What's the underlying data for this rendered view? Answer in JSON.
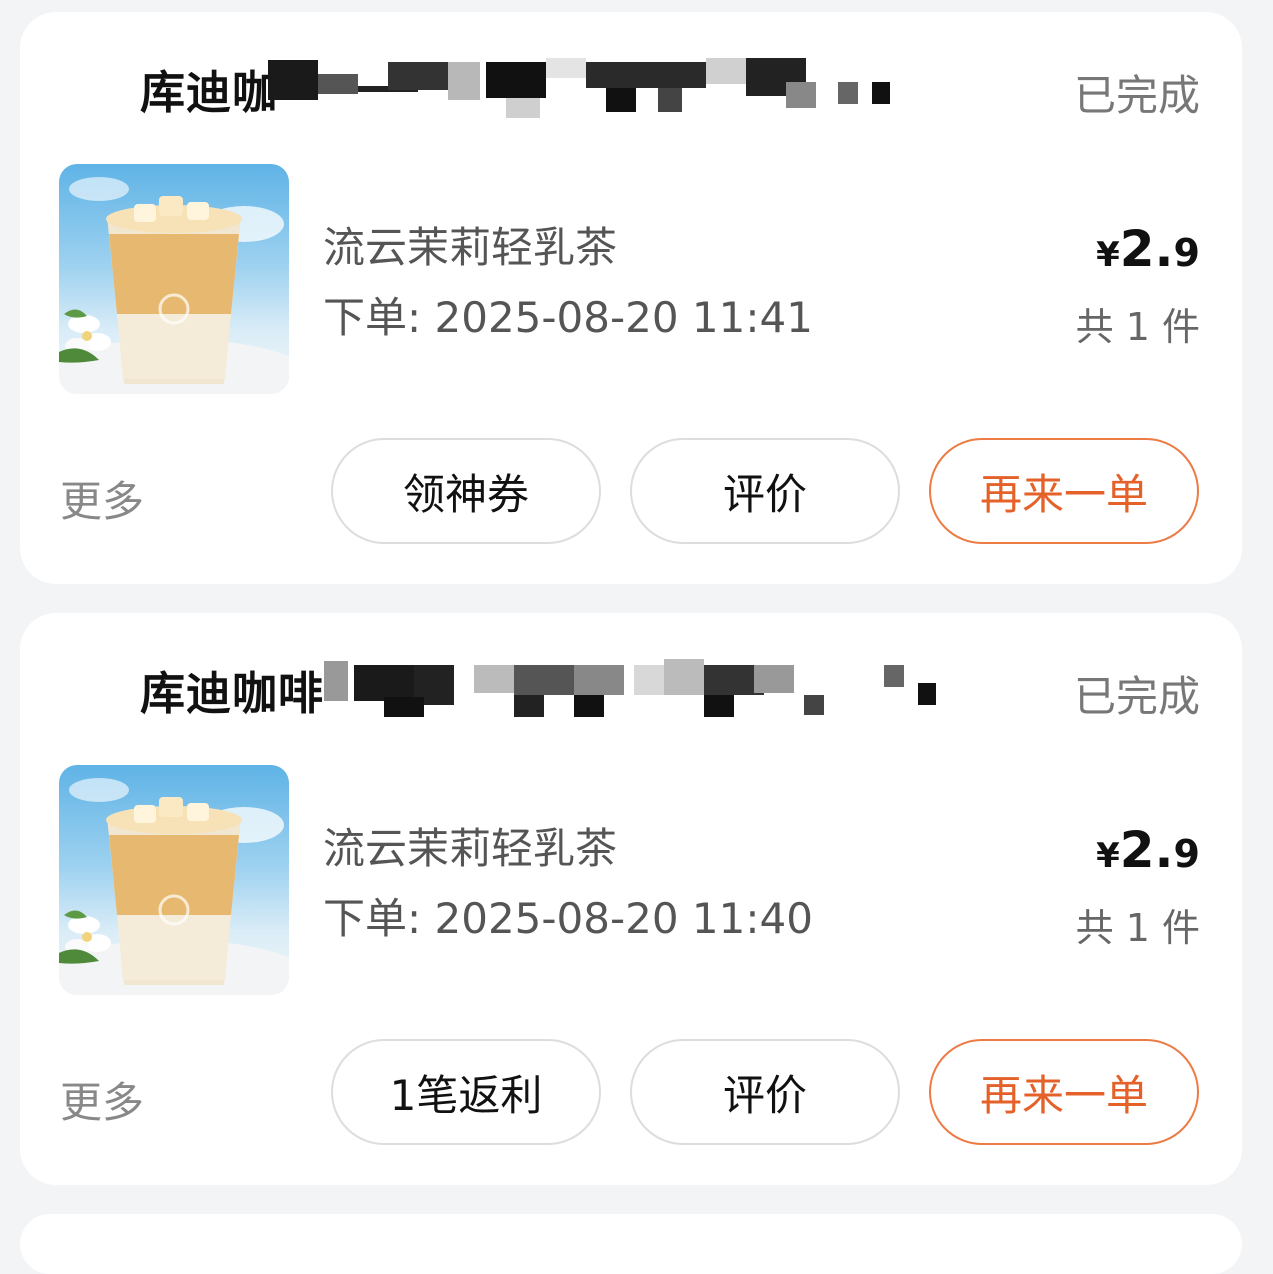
{
  "orders": [
    {
      "store_name": "库迪咖",
      "status": "已完成",
      "product_name": "流云茉莉轻乳茶",
      "order_time": "下单: 2025-08-20 11:41",
      "price_symbol": "¥",
      "price_integer": "2.",
      "price_decimal": "9",
      "quantity": "共 1 件",
      "more_label": "更多",
      "buttons": [
        "领神券",
        "评价",
        "再来一单"
      ]
    },
    {
      "store_name": "库迪咖啡",
      "status": "已完成",
      "product_name": "流云茉莉轻乳茶",
      "order_time": "下单: 2025-08-20 11:40",
      "price_symbol": "¥",
      "price_integer": "2.",
      "price_decimal": "9",
      "quantity": "共 1 件",
      "more_label": "更多",
      "buttons": [
        "1笔返利",
        "评价",
        "再来一单"
      ]
    }
  ],
  "colors": {
    "page_background": "#f3f4f6",
    "card_background": "#ffffff",
    "accent_orange": "#e4622a",
    "status_gray": "#777777"
  },
  "icons": {
    "product_image": "iced-milk-tea-with-jasmine-image",
    "redaction": "pixel-mosaic"
  }
}
